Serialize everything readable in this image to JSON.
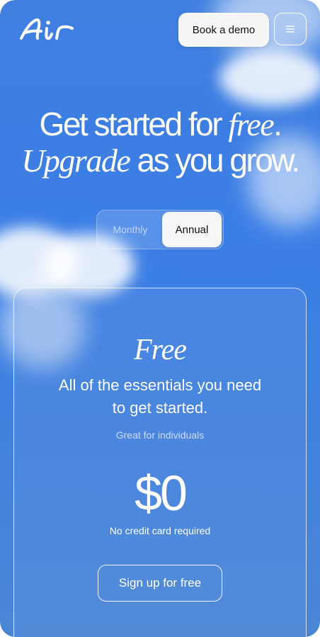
{
  "header": {
    "logo_text": "Air",
    "book_demo_label": "Book a demo",
    "menu_icon": "hamburger-menu-icon"
  },
  "hero": {
    "line1_a": "Get started for ",
    "line1_b": "free",
    "line1_c": ".",
    "line2_a": "Upgrade",
    "line2_b": " as you grow."
  },
  "billing_toggle": {
    "options": [
      "Monthly",
      "Annual"
    ],
    "selected": "Annual"
  },
  "plan": {
    "name": "Free",
    "description": "All of the essentials you need to get started.",
    "audience": "Great for individuals",
    "price": "$0",
    "price_note": "No credit card required",
    "cta_label": "Sign up for free"
  },
  "colors": {
    "sky_blue": "#3b7ee6",
    "text": "#ffffff",
    "button_light": "#f5f5f5"
  }
}
